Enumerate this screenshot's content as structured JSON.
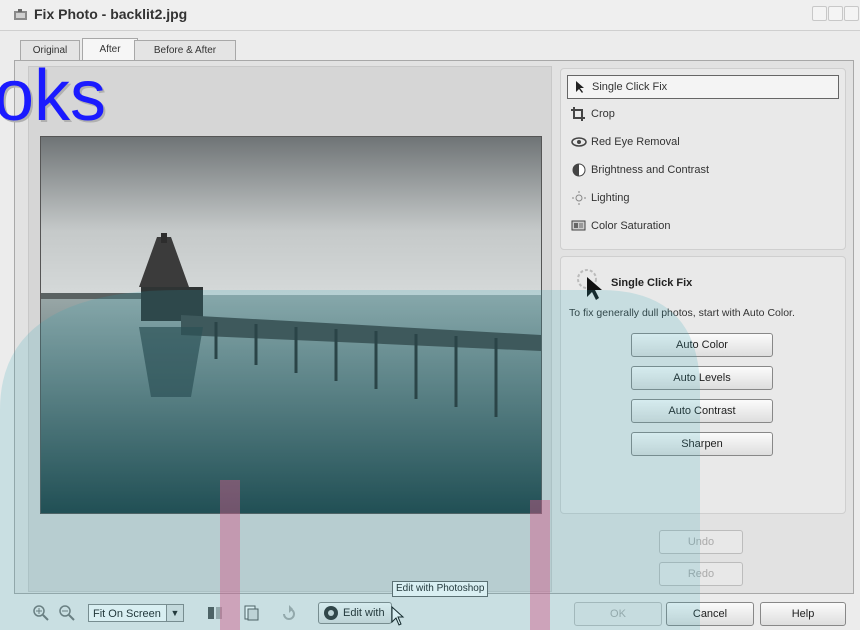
{
  "window": {
    "title": "Fix Photo - backlit2.jpg"
  },
  "tabs": [
    {
      "label": "Original"
    },
    {
      "label": "After"
    },
    {
      "label": "Before & After"
    }
  ],
  "overlay": {
    "text": "oks"
  },
  "tools": [
    {
      "label": "Single Click Fix",
      "icon": "cursor-icon"
    },
    {
      "label": "Crop",
      "icon": "crop-icon"
    },
    {
      "label": "Red Eye Removal",
      "icon": "red-eye-icon"
    },
    {
      "label": "Brightness and Contrast",
      "icon": "brightness-icon"
    },
    {
      "label": "Lighting",
      "icon": "lighting-icon"
    },
    {
      "label": "Color Saturation",
      "icon": "saturation-icon"
    }
  ],
  "fix_panel": {
    "title": "Single Click Fix",
    "description": "To fix generally dull photos, start with Auto Color.",
    "buttons": [
      "Auto Color",
      "Auto Levels",
      "Auto Contrast",
      "Sharpen"
    ]
  },
  "history": {
    "undo": "Undo",
    "redo": "Redo"
  },
  "toolbar": {
    "zoom_select": "Fit On Screen",
    "edit_with": "Edit with",
    "tooltip": "Edit with Photoshop"
  },
  "dialog_buttons": {
    "ok": "OK",
    "cancel": "Cancel",
    "help": "Help"
  },
  "colors": {
    "accent_overlay": "#1a1aff",
    "watermark": "#2aa6b5"
  }
}
